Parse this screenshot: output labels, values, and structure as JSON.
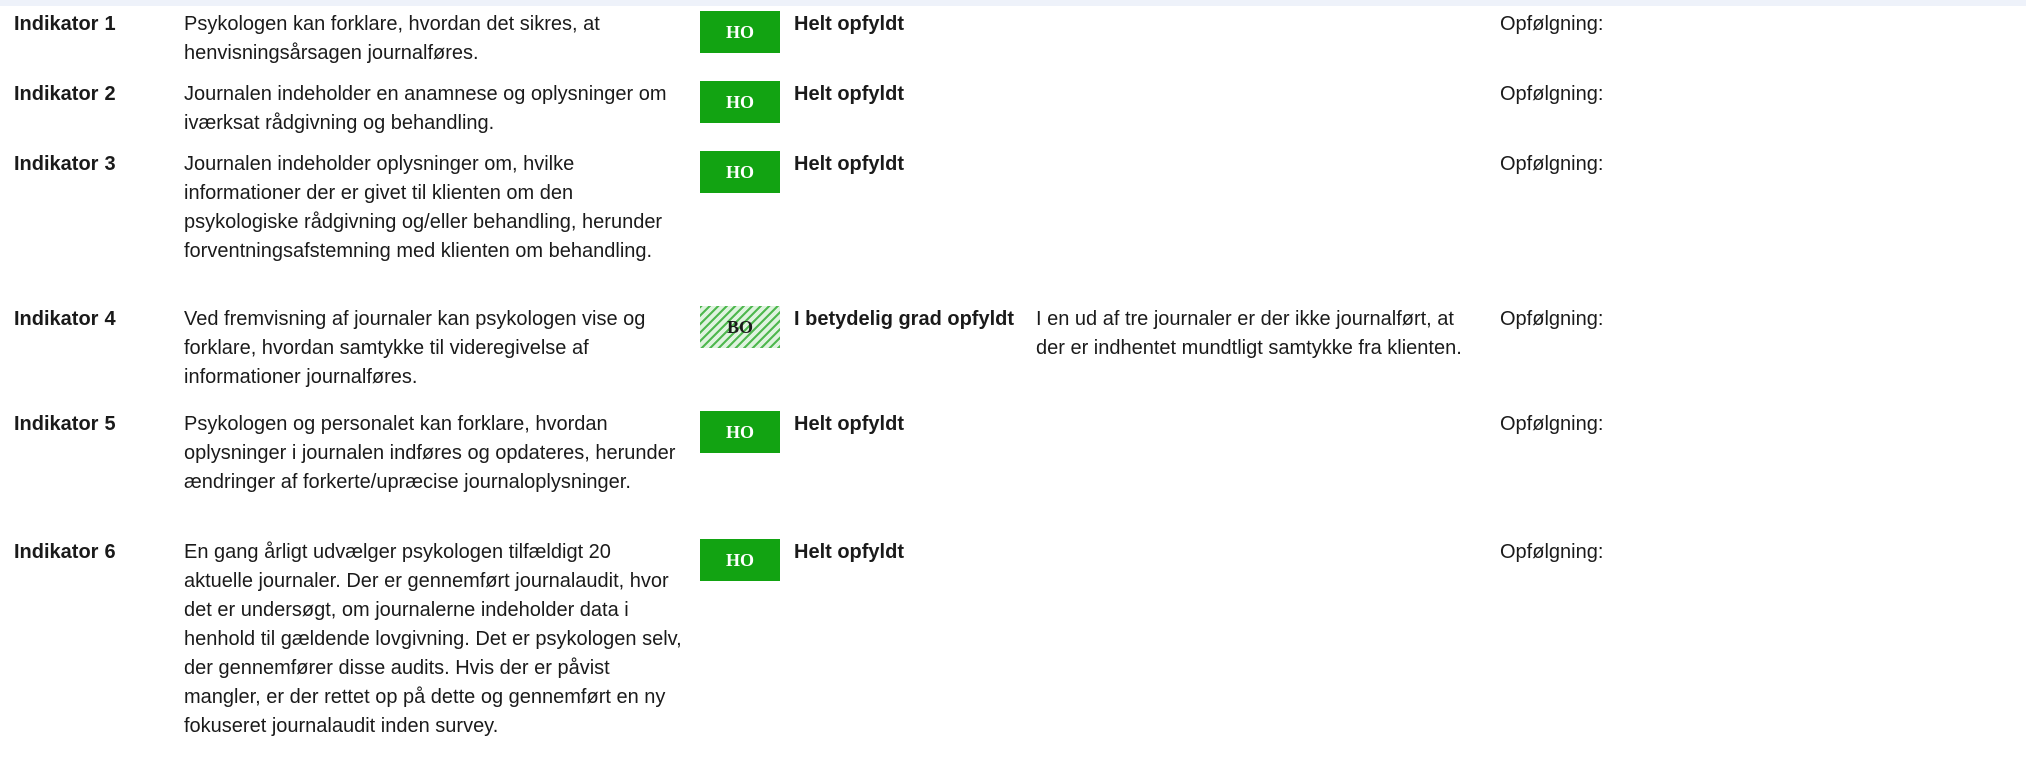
{
  "indicators": [
    {
      "label": "Indikator",
      "number": "1",
      "description": "Psykologen kan forklare, hvordan det sikres, at henvisningsårsagen journalføres.",
      "badge": "HO",
      "status": "Helt opfyldt",
      "comment": "",
      "followup": "Opfølgning:"
    },
    {
      "label": "Indikator",
      "number": "2",
      "description": "Journalen indeholder en anamnese og oplysninger om iværksat rådgivning og behandling.",
      "badge": "HO",
      "status": "Helt opfyldt",
      "comment": "",
      "followup": "Opfølgning:"
    },
    {
      "label": "Indikator",
      "number": "3",
      "description": "Journalen indeholder oplysninger om, hvilke informationer der er givet til klienten om den psykologiske rådgivning og/eller behandling, herunder forventningsafstemning med klienten om behandling.",
      "badge": "HO",
      "status": "Helt opfyldt",
      "comment": "",
      "followup": "Opfølgning:"
    },
    {
      "label": "Indikator",
      "number": "4",
      "description": "Ved fremvisning af journaler kan psykologen vise og forklare, hvordan samtykke til videregivelse af informationer journalføres.",
      "badge": "BO",
      "status": "I betydelig grad opfyldt",
      "comment": "I en ud af tre journaler er der ikke journalført, at der er indhentet mundtligt samtykke fra klienten.",
      "followup": "Opfølgning:"
    },
    {
      "label": "Indikator",
      "number": "5",
      "description": "Psykologen og personalet kan forklare, hvordan oplysninger i journalen indføres og opdateres, herunder ændringer af forkerte/upræcise journaloplysninger.",
      "badge": "HO",
      "status": "Helt opfyldt",
      "comment": "",
      "followup": "Opfølgning:"
    },
    {
      "label": "Indikator",
      "number": "6",
      "description": "En gang årligt udvælger psykologen tilfældigt 20 aktuelle journaler. Der er gennemført journalaudit, hvor det er undersøgt, om journalerne indeholder data i henhold til gældende lovgivning. Det er psykologen selv, der gennemfører disse audits. Hvis der er påvist mangler, er der rettet op på dette og gennemført en ny fokuseret journalaudit inden survey.",
      "badge": "HO",
      "status": "Helt opfyldt",
      "comment": "",
      "followup": "Opfølgning:"
    }
  ],
  "colors": {
    "ho_badge": "#12a312",
    "bo_badge_stripe": "#4fb84f",
    "top_band": "#eef2fa"
  }
}
